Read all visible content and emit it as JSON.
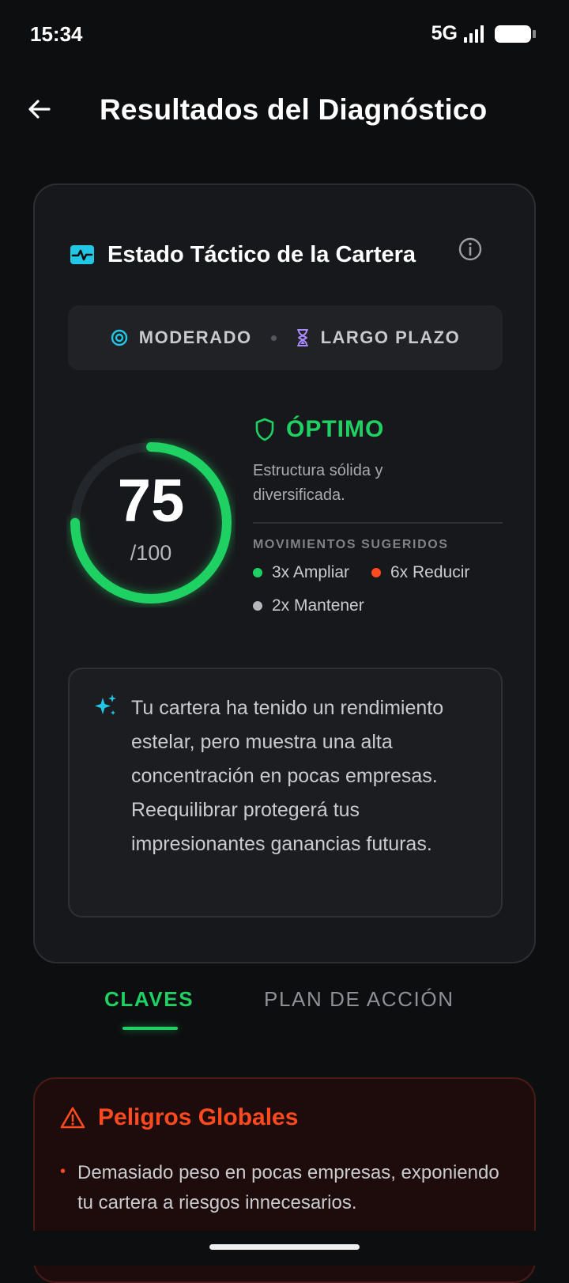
{
  "status_bar": {
    "time": "15:34",
    "network": "5G"
  },
  "header": {
    "title": "Resultados del Diagnóstico"
  },
  "summary_card": {
    "title": "Estado Táctico de la Cartera",
    "profile": {
      "risk": "MODERADO",
      "horizon": "LARGO PLAZO"
    },
    "score": {
      "value": "75",
      "max": "/100",
      "fraction": 0.75
    },
    "status": {
      "label": "ÓPTIMO",
      "description": "Estructura sólida y diversificada."
    },
    "moves": {
      "title": "MOVIMIENTOS SUGERIDOS",
      "items": [
        {
          "label": "3x Ampliar",
          "color": "#1fd062"
        },
        {
          "label": "6x Reducir",
          "color": "#ff4a1f"
        },
        {
          "label": "2x Mantener",
          "color": "#b5b7bc"
        }
      ]
    },
    "insight": "Tu cartera ha tenido un rendimiento estelar, pero muestra una alta concentración en pocas empresas. Reequilibrar protegerá tus impresionantes ganancias futuras."
  },
  "tabs": [
    {
      "label": "CLAVES",
      "active": true
    },
    {
      "label": "PLAN DE ACCIÓN",
      "active": false
    }
  ],
  "danger_card": {
    "title": "Peligros Globales",
    "items": [
      "Demasiado peso en pocas empresas, exponiendo tu cartera a riesgos innecesarios."
    ]
  },
  "colors": {
    "accent_green": "#1fd062",
    "danger_orange": "#ff4a1f",
    "cyan": "#22c7e6",
    "purple": "#a98bff"
  },
  "icons": {
    "back": "arrow-left-icon",
    "header": "pulse-icon",
    "info": "info-icon",
    "risk": "target-icon",
    "horizon": "hourglass-icon",
    "status": "shield-icon",
    "insight": "sparkle-icon",
    "danger": "warning-icon"
  }
}
